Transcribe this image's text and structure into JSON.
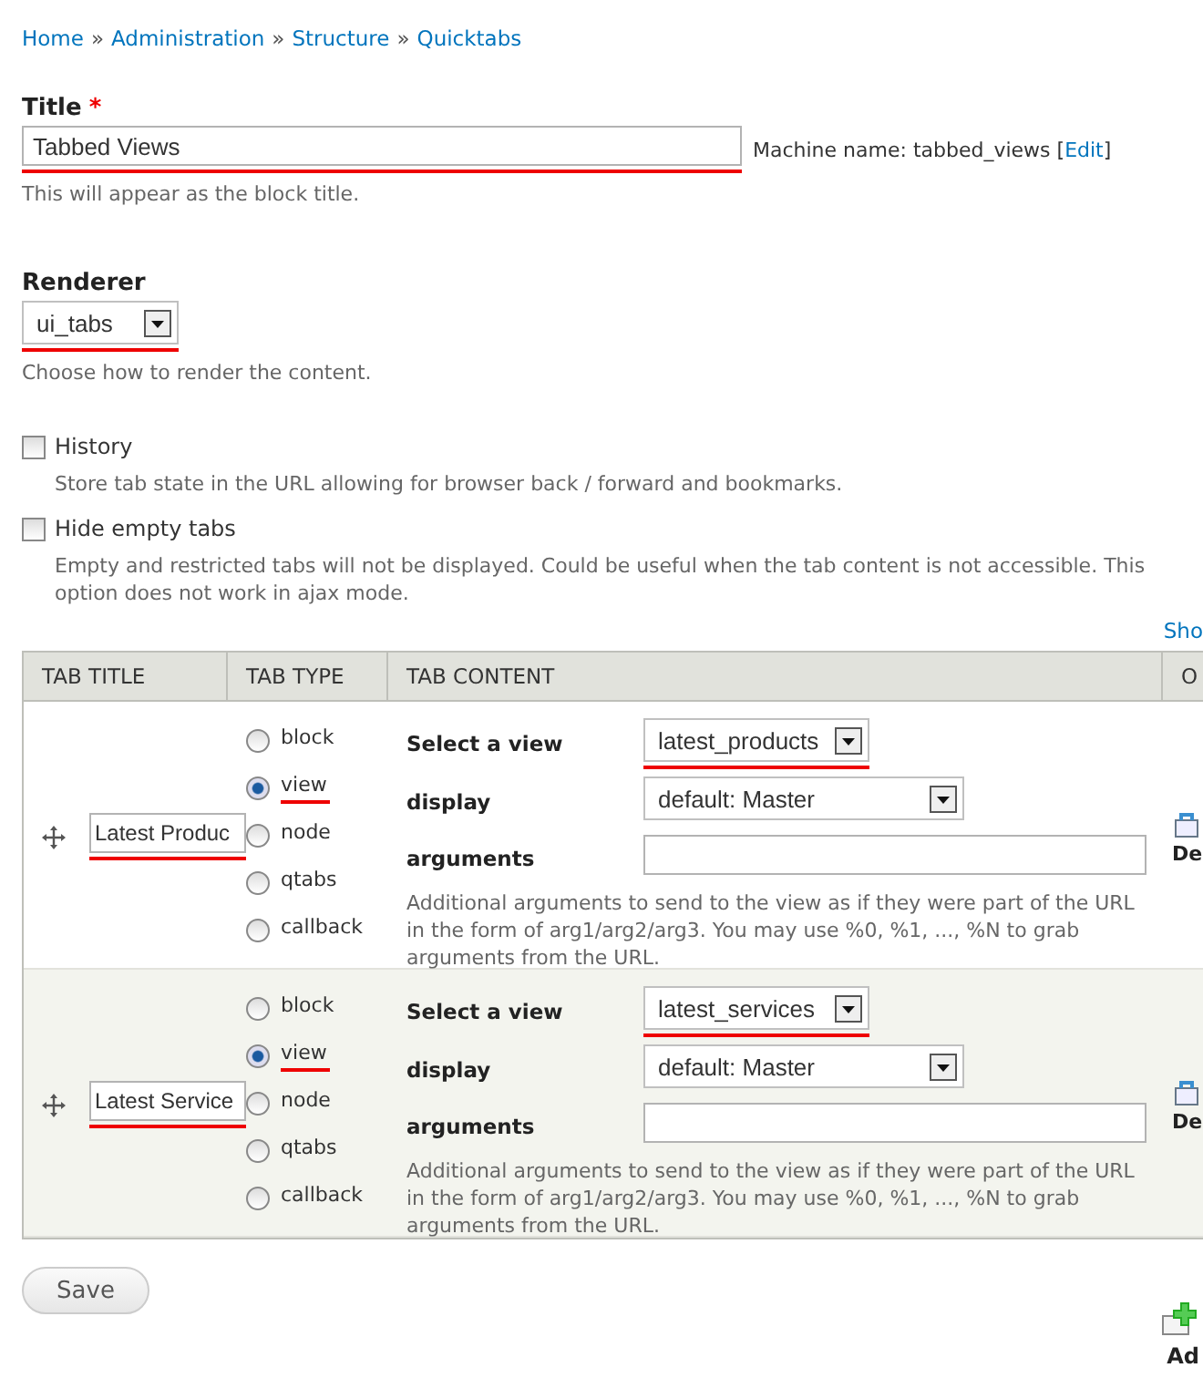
{
  "breadcrumb": [
    "Home",
    "Administration",
    "Structure",
    "Quicktabs"
  ],
  "breadcrumb_separator": "»",
  "title_field": {
    "label": "Title",
    "required_mark": "*",
    "value": "Tabbed Views",
    "underlined": true,
    "machine_name": "Machine name: tabbed_views [",
    "edit_link": "Edit",
    "close_bracket": "]",
    "description": "This will appear as the block title."
  },
  "renderer": {
    "label": "Renderer",
    "value": "ui_tabs",
    "underlined": true,
    "description": "Choose how to render the content."
  },
  "options": [
    {
      "label": "History",
      "checked": false,
      "description": "Store tab state in the URL allowing for browser back / forward and bookmarks."
    },
    {
      "label": "Hide empty tabs",
      "checked": false,
      "description": "Empty and restricted tabs will not be displayed. Could be useful when the tab content is not accessible. This option does not work in ajax mode."
    }
  ],
  "show_link": "Sho",
  "table": {
    "columns": [
      "TAB TITLE",
      "TAB TYPE",
      "TAB CONTENT",
      "O"
    ],
    "rows": [
      {
        "title": "Latest Produc",
        "title_underlined": true,
        "striped": false,
        "types": [
          {
            "label": "block",
            "selected": false,
            "underlined": false
          },
          {
            "label": "view",
            "selected": true,
            "underlined": true
          },
          {
            "label": "node",
            "selected": false,
            "underlined": false
          },
          {
            "label": "qtabs",
            "selected": false,
            "underlined": false
          },
          {
            "label": "callback",
            "selected": false,
            "underlined": false
          }
        ],
        "fields": [
          {
            "label": "Select a view",
            "kind": "select",
            "value": "latest_products",
            "underlined": true,
            "wide": false
          },
          {
            "label": "display",
            "kind": "select",
            "value": "default: Master",
            "underlined": false,
            "wide": true
          },
          {
            "label": "arguments",
            "kind": "text",
            "underlined": false,
            "wide": true
          }
        ],
        "help": "Additional arguments to send to the view as if they were part of the URL in the form of arg1/arg2/arg3. You may use %0, %1, ..., %N to grab arguments from the URL.",
        "operation": "De"
      },
      {
        "title": "Latest Service",
        "title_underlined": true,
        "striped": true,
        "types": [
          {
            "label": "block",
            "selected": false,
            "underlined": false
          },
          {
            "label": "view",
            "selected": true,
            "underlined": true
          },
          {
            "label": "node",
            "selected": false,
            "underlined": false
          },
          {
            "label": "qtabs",
            "selected": false,
            "underlined": false
          },
          {
            "label": "callback",
            "selected": false,
            "underlined": false
          }
        ],
        "fields": [
          {
            "label": "Select a view",
            "kind": "select",
            "value": "latest_services",
            "underlined": true,
            "wide": false
          },
          {
            "label": "display",
            "kind": "select",
            "value": "default: Master",
            "underlined": false,
            "wide": true
          },
          {
            "label": "arguments",
            "kind": "text",
            "underlined": false,
            "wide": true
          }
        ],
        "help": "Additional arguments to send to the view as if they were part of the URL in the form of arg1/arg2/arg3. You may use %0, %1, ..., %N to grab arguments from the URL.",
        "operation": "De"
      }
    ]
  },
  "save_button": "Save",
  "add_link": "Ad"
}
